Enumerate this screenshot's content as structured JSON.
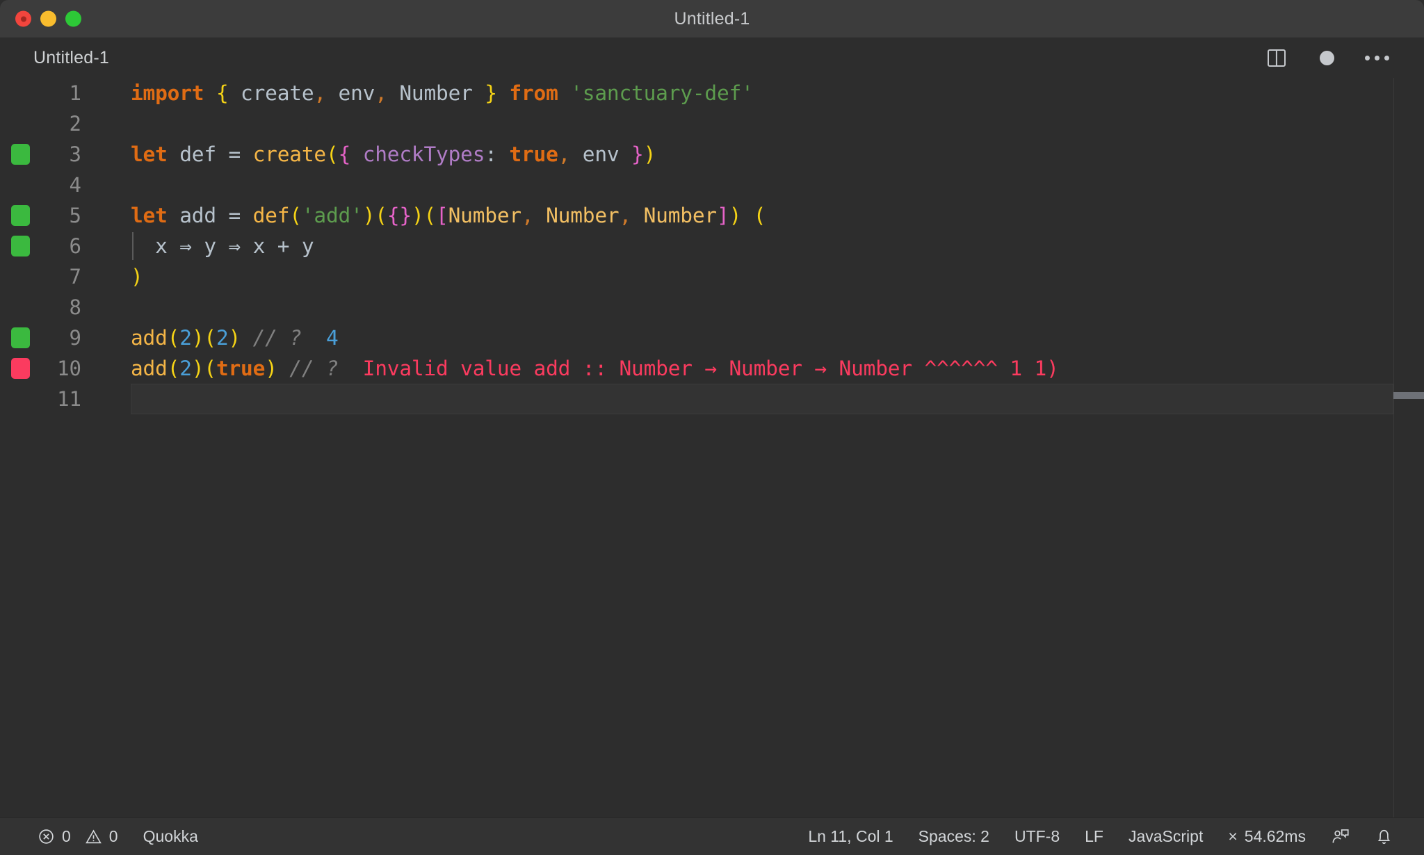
{
  "window": {
    "title": "Untitled-1",
    "traffic_lights": [
      "close",
      "minimize",
      "maximize"
    ]
  },
  "tabstrip": {
    "tab_label": "Untitled-1",
    "actions": {
      "split_editor": "Split Editor",
      "unsaved_indicator": "Unsaved changes",
      "more_actions": "More Actions..."
    }
  },
  "editor": {
    "language": "JavaScript",
    "lines": [
      {
        "number": "1",
        "marker": "none",
        "current": false,
        "indent_guide": false,
        "tokens": [
          {
            "c": "t-kw",
            "t": "import"
          },
          {
            "c": "t-plain",
            "t": " "
          },
          {
            "c": "t-b1",
            "t": "{"
          },
          {
            "c": "t-var",
            "t": " create"
          },
          {
            "c": "t-punct",
            "t": ","
          },
          {
            "c": "t-var",
            "t": " env"
          },
          {
            "c": "t-punct",
            "t": ","
          },
          {
            "c": "t-var",
            "t": " Number "
          },
          {
            "c": "t-b1",
            "t": "}"
          },
          {
            "c": "t-plain",
            "t": " "
          },
          {
            "c": "t-kw",
            "t": "from"
          },
          {
            "c": "t-plain",
            "t": " "
          },
          {
            "c": "t-str",
            "t": "'sanctuary-def'"
          }
        ]
      },
      {
        "number": "2",
        "marker": "none",
        "current": false,
        "indent_guide": false,
        "tokens": []
      },
      {
        "number": "3",
        "marker": "ok",
        "current": false,
        "indent_guide": false,
        "tokens": [
          {
            "c": "t-kw",
            "t": "let"
          },
          {
            "c": "t-var",
            "t": " def "
          },
          {
            "c": "t-op",
            "t": "="
          },
          {
            "c": "t-plain",
            "t": " "
          },
          {
            "c": "t-fn",
            "t": "create"
          },
          {
            "c": "t-b1",
            "t": "("
          },
          {
            "c": "t-b2",
            "t": "{"
          },
          {
            "c": "t-plain",
            "t": " "
          },
          {
            "c": "t-prop",
            "t": "checkTypes"
          },
          {
            "c": "t-plain",
            "t": ": "
          },
          {
            "c": "t-bool",
            "t": "true"
          },
          {
            "c": "t-punct",
            "t": ","
          },
          {
            "c": "t-var",
            "t": " env "
          },
          {
            "c": "t-b2",
            "t": "}"
          },
          {
            "c": "t-b1",
            "t": ")"
          }
        ]
      },
      {
        "number": "4",
        "marker": "none",
        "current": false,
        "indent_guide": false,
        "tokens": []
      },
      {
        "number": "5",
        "marker": "ok",
        "current": false,
        "indent_guide": false,
        "tokens": [
          {
            "c": "t-kw",
            "t": "let"
          },
          {
            "c": "t-var",
            "t": " add "
          },
          {
            "c": "t-op",
            "t": "="
          },
          {
            "c": "t-plain",
            "t": " "
          },
          {
            "c": "t-fn",
            "t": "def"
          },
          {
            "c": "t-b1",
            "t": "("
          },
          {
            "c": "t-str",
            "t": "'add'"
          },
          {
            "c": "t-b1",
            "t": ")"
          },
          {
            "c": "t-b1",
            "t": "("
          },
          {
            "c": "t-b2",
            "t": "{}"
          },
          {
            "c": "t-b1",
            "t": ")"
          },
          {
            "c": "t-b1",
            "t": "("
          },
          {
            "c": "t-b2",
            "t": "["
          },
          {
            "c": "t-type",
            "t": "Number"
          },
          {
            "c": "t-punct",
            "t": ","
          },
          {
            "c": "t-type",
            "t": " Number"
          },
          {
            "c": "t-punct",
            "t": ","
          },
          {
            "c": "t-type",
            "t": " Number"
          },
          {
            "c": "t-b2",
            "t": "]"
          },
          {
            "c": "t-b1",
            "t": ")"
          },
          {
            "c": "t-plain",
            "t": " "
          },
          {
            "c": "t-b1",
            "t": "("
          }
        ]
      },
      {
        "number": "6",
        "marker": "ok",
        "current": false,
        "indent_guide": true,
        "tokens": [
          {
            "c": "t-var",
            "t": "  x "
          },
          {
            "c": "t-op",
            "t": "⇒"
          },
          {
            "c": "t-var",
            "t": " y "
          },
          {
            "c": "t-op",
            "t": "⇒"
          },
          {
            "c": "t-var",
            "t": " x "
          },
          {
            "c": "t-op",
            "t": "+"
          },
          {
            "c": "t-var",
            "t": " y"
          }
        ]
      },
      {
        "number": "7",
        "marker": "none",
        "current": false,
        "indent_guide": false,
        "tokens": [
          {
            "c": "t-b1",
            "t": ")"
          }
        ]
      },
      {
        "number": "8",
        "marker": "none",
        "current": false,
        "indent_guide": false,
        "tokens": []
      },
      {
        "number": "9",
        "marker": "ok",
        "current": false,
        "indent_guide": false,
        "tokens": [
          {
            "c": "t-fn",
            "t": "add"
          },
          {
            "c": "t-b1",
            "t": "("
          },
          {
            "c": "t-num",
            "t": "2"
          },
          {
            "c": "t-b1",
            "t": ")"
          },
          {
            "c": "t-b1",
            "t": "("
          },
          {
            "c": "t-num",
            "t": "2"
          },
          {
            "c": "t-b1",
            "t": ")"
          },
          {
            "c": "t-comment",
            "t": " // ?"
          },
          {
            "c": "t-result",
            "t": "  4"
          }
        ]
      },
      {
        "number": "10",
        "marker": "err",
        "current": false,
        "indent_guide": false,
        "tokens": [
          {
            "c": "t-fn",
            "t": "add"
          },
          {
            "c": "t-b1",
            "t": "("
          },
          {
            "c": "t-num",
            "t": "2"
          },
          {
            "c": "t-b1",
            "t": ")"
          },
          {
            "c": "t-b1",
            "t": "("
          },
          {
            "c": "t-bool",
            "t": "true"
          },
          {
            "c": "t-b1",
            "t": ")"
          },
          {
            "c": "t-comment",
            "t": " // ?"
          },
          {
            "c": "t-error",
            "t": "  Invalid value add :: Number → Number → Number ^^^^^^ 1 1)"
          }
        ]
      },
      {
        "number": "11",
        "marker": "none",
        "current": true,
        "indent_guide": false,
        "tokens": []
      }
    ]
  },
  "statusbar": {
    "errors_count": "0",
    "warnings_count": "0",
    "quokka_label": "Quokka",
    "cursor_position": "Ln 11, Col 1",
    "indentation": "Spaces: 2",
    "encoding": "UTF-8",
    "eol": "LF",
    "language_mode": "JavaScript",
    "quokka_timing": "54.62ms",
    "quokka_timing_prefix": "×",
    "feedback_icon": "feedback-person-icon",
    "notifications_icon": "bell-icon"
  },
  "colors": {
    "titlebar_bg": "#3c3c3c",
    "editor_bg": "#2d2d2d",
    "statusbar_bg": "#333333",
    "keyword": "#e06c14",
    "function": "#f5b647",
    "string": "#5d9c4e",
    "type": "#f2bf63",
    "property": "#b07cc6",
    "number": "#4a9fd8",
    "comment": "#808080",
    "bracket_level1": "#f5d316",
    "bracket_level2": "#e763c9",
    "quokka_ok": "#3bb93f",
    "quokka_error": "#fb3b5f"
  }
}
